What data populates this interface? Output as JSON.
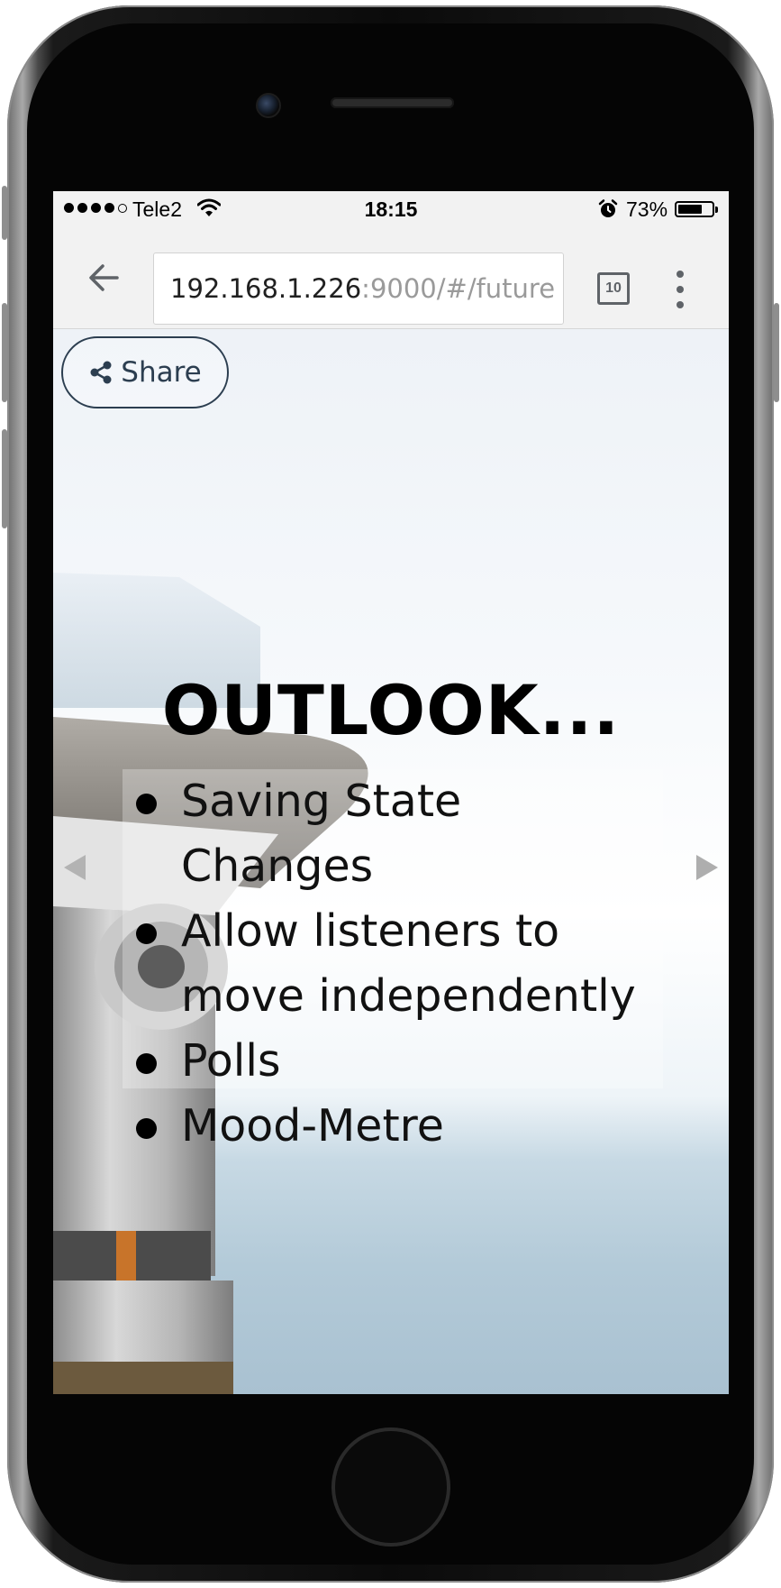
{
  "status_bar": {
    "carrier": "Tele2",
    "time": "18:15",
    "battery_percent": "73%",
    "battery_level": 0.73,
    "signal_bars_filled": 4,
    "signal_bars_total": 5
  },
  "browser": {
    "url_host": "192.168.1.226",
    "url_path": ":9000/#/future",
    "tab_count": "10"
  },
  "slide": {
    "share_label": "Share",
    "title": "OUTLOOK...",
    "bullets": [
      "Saving State Changes",
      "Allow listeners to move independently",
      "Polls",
      "Mood-Metre"
    ]
  },
  "colors": {
    "share_border": "#2c3e50",
    "toolbar_bg": "#f2f2f2",
    "url_path_gray": "#9a9a9a"
  },
  "icons": [
    "back-arrow-icon",
    "share-icon",
    "wifi-icon",
    "alarm-icon",
    "battery-icon",
    "tabs-icon",
    "overflow-menu-icon",
    "previous-slide-icon",
    "next-slide-icon"
  ]
}
